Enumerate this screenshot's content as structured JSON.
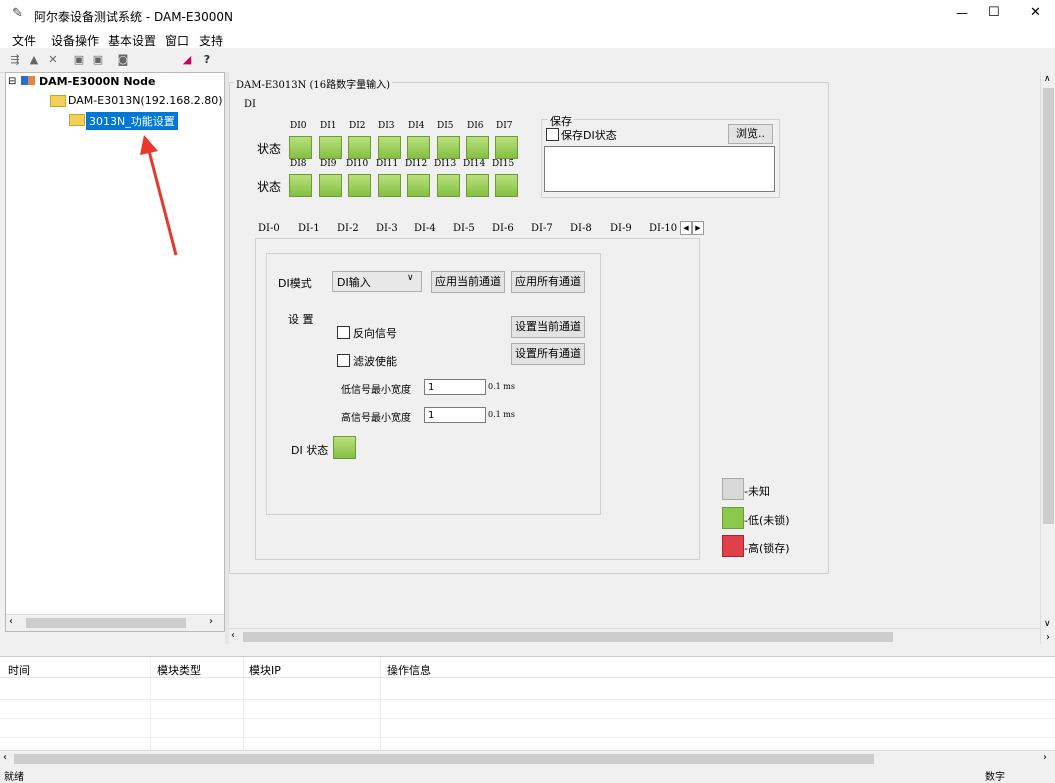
{
  "window": {
    "title": "阿尔泰设备测试系统 - DAM-E3000N",
    "minimize_glyph": "—",
    "maximize_glyph": "☐",
    "close_glyph": "✕"
  },
  "menu": [
    "文件",
    "设备操作",
    "基本设置",
    "窗口",
    "支持"
  ],
  "tree": {
    "root": "DAM-E3000N Node",
    "device": "DAM-E3013N(192.168.2.80)",
    "function": "3013N_功能设置",
    "expander": "⊟"
  },
  "panel": {
    "title": "DAM-E3013N (16路数字量输入)",
    "di_group": "DI",
    "status_label": "状态",
    "di_labels_row1": [
      "DI0",
      "DI1",
      "DI2",
      "DI3",
      "DI4",
      "DI5",
      "DI6",
      "DI7"
    ],
    "di_labels_row2": [
      "DI8",
      "DI9",
      "DI10",
      "DI11",
      "DI12",
      "DI13",
      "DI14",
      "DI15"
    ],
    "save_group": "保存",
    "save_checkbox": "保存DI状态",
    "browse_button": "浏览..",
    "tabs": [
      "DI-0",
      "DI-1",
      "DI-2",
      "DI-3",
      "DI-4",
      "DI-5",
      "DI-6",
      "DI-7",
      "DI-8",
      "DI-9",
      "DI-10"
    ],
    "di_mode_label": "DI模式",
    "di_mode_value": "DI输入",
    "apply_current": "应用当前通道",
    "apply_all": "应用所有通道",
    "settings_label": "设 置",
    "invert_signal": "反向信号",
    "filter_enable": "滤波使能",
    "set_current": "设置当前通道",
    "set_all": "设置所有通道",
    "low_width_label": "低信号最小宽度",
    "low_width_value": "1",
    "high_width_label": "高信号最小宽度",
    "high_width_value": "1",
    "unit": "0.1 ms",
    "di_status_label": "DI 状态",
    "legend": [
      {
        "label": "-未知",
        "color": "#d8d8d8"
      },
      {
        "label": "-低(未锁)",
        "color": "#8cc84b"
      },
      {
        "label": "-高(锁存)",
        "color": "#e0404a"
      }
    ]
  },
  "log": {
    "columns": [
      "时间",
      "模块类型",
      "模块IP",
      "操作信息"
    ]
  },
  "status": {
    "left": "就绪",
    "right": "数字"
  },
  "indicator_colors": {
    "green": "#8cc84b"
  }
}
